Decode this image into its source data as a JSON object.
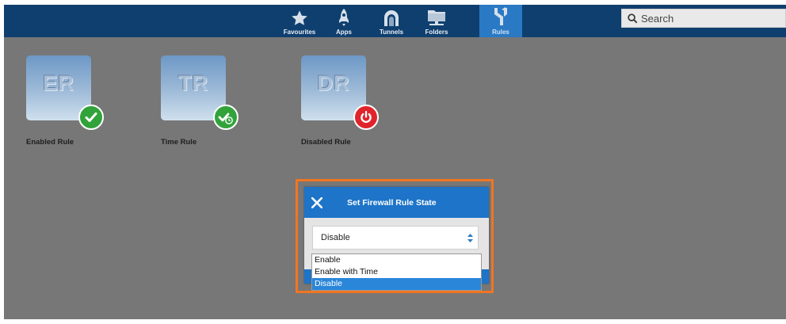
{
  "topbar": {
    "nav": [
      {
        "label": "Favourites",
        "icon": "star-icon",
        "active": false
      },
      {
        "label": "Apps",
        "icon": "rocket-icon",
        "active": false
      },
      {
        "label": "Tunnels",
        "icon": "tunnel-icon",
        "active": false
      },
      {
        "label": "Folders",
        "icon": "folder-icon",
        "active": false
      },
      {
        "label": "Rules",
        "icon": "rules-icon",
        "active": true
      }
    ],
    "search": {
      "placeholder": "Search",
      "value": ""
    }
  },
  "rules": [
    {
      "abbr": "ER",
      "name": "Enabled Rule",
      "status": "enabled",
      "status_icon": "check-icon",
      "badge_color": "#31a33a"
    },
    {
      "abbr": "TR",
      "name": "Time Rule",
      "status": "enabled-with-time",
      "status_icon": "check-clock-icon",
      "badge_color": "#31a33a"
    },
    {
      "abbr": "DR",
      "name": "Disabled Rule",
      "status": "disabled",
      "status_icon": "power-icon",
      "badge_color": "#e0242b"
    }
  ],
  "dialog": {
    "title": "Set Firewall Rule State",
    "selected": "Disable",
    "options": [
      "Enable",
      "Enable with Time",
      "Disable"
    ],
    "highlight_color": "#f07622"
  },
  "colors": {
    "topbar": "#0f3f6e",
    "accent": "#1d74c8",
    "background": "#777777"
  }
}
